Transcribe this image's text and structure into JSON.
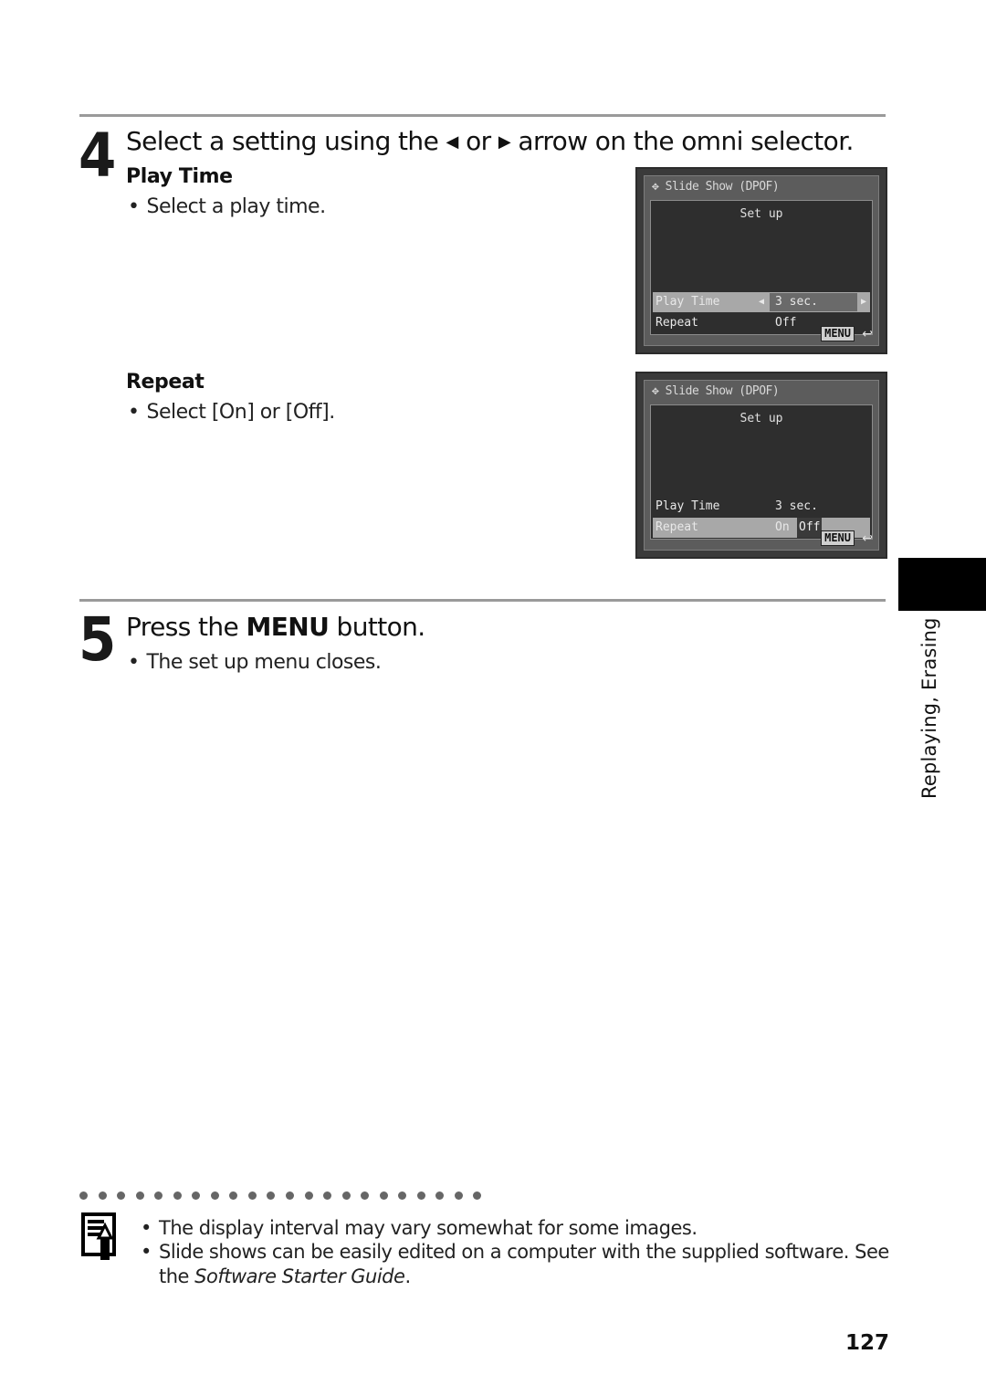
{
  "step4": {
    "number": "4",
    "title_before": "Select a setting using the",
    "left_arrow": "◀",
    "title_mid": "or",
    "right_arrow": "▶",
    "title_after": "arrow on the omni selector.",
    "play_time": {
      "heading": "Play Time",
      "bullet": "Select a play time."
    },
    "repeat": {
      "heading": "Repeat",
      "bullet": "Select [On] or [Off]."
    }
  },
  "screens": [
    {
      "title": "Slide Show (DPOF)",
      "subtitle": "Set up",
      "rows": [
        {
          "label": "Play Time",
          "value": "3 sec.",
          "selected": true
        },
        {
          "label": "Repeat",
          "value": "Off",
          "selected": false
        }
      ],
      "menu_label": "MENU",
      "return_icon": "↩"
    },
    {
      "title": "Slide Show (DPOF)",
      "subtitle": "Set up",
      "rows": [
        {
          "label": "Play Time",
          "value": "3 sec.",
          "selected": false
        },
        {
          "label": "Repeat",
          "option_on": "On",
          "option_off": "Off",
          "selected": true
        }
      ],
      "menu_label": "MENU",
      "return_icon": "↩"
    }
  ],
  "step5": {
    "number": "5",
    "title_before": "Press the",
    "title_bold": "MENU",
    "title_after": "button.",
    "bullet": "The set up menu closes."
  },
  "side_tab": {
    "label": "Replaying, Erasing"
  },
  "note": {
    "icon": "note-pencil-icon",
    "items": [
      {
        "text": "The display interval may vary somewhat for some images."
      },
      {
        "text_before": "Slide shows can be easily edited on a computer with the supplied software. See",
        "text_line2_before": "the",
        "text_italic": "Software Starter Guide",
        "text_after": "."
      }
    ]
  },
  "bullet_char": "•",
  "page_number": "127"
}
